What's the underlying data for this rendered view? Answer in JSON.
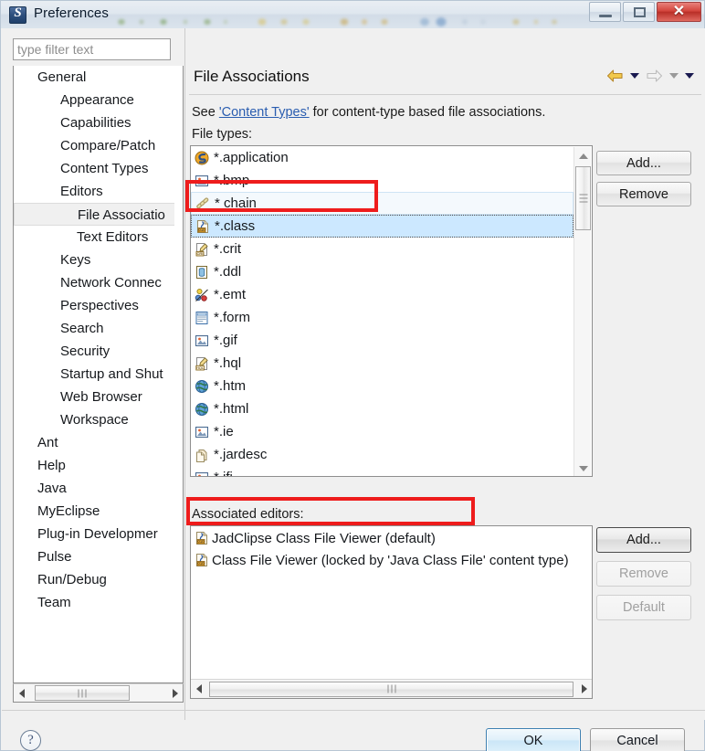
{
  "window": {
    "title": "Preferences",
    "app_icon": "myeclipse-logo-icon",
    "controls": {
      "minimize": "minimize-icon",
      "maximize": "maximize-icon",
      "close": "✕"
    }
  },
  "sidebar": {
    "filter": {
      "value": "",
      "placeholder": "type filter text"
    },
    "items": [
      {
        "label": "General",
        "level": 0,
        "selected": false
      },
      {
        "label": "Appearance",
        "level": 1,
        "selected": false
      },
      {
        "label": "Capabilities",
        "level": 1,
        "selected": false
      },
      {
        "label": "Compare/Patch",
        "level": 1,
        "selected": false
      },
      {
        "label": "Content Types",
        "level": 1,
        "selected": false
      },
      {
        "label": "Editors",
        "level": 1,
        "selected": false
      },
      {
        "label": "File Associatio",
        "level": 2,
        "selected": true
      },
      {
        "label": "Text Editors",
        "level": 2,
        "selected": false
      },
      {
        "label": "Keys",
        "level": 1,
        "selected": false
      },
      {
        "label": "Network Connec",
        "level": 1,
        "selected": false
      },
      {
        "label": "Perspectives",
        "level": 1,
        "selected": false
      },
      {
        "label": "Search",
        "level": 1,
        "selected": false
      },
      {
        "label": "Security",
        "level": 1,
        "selected": false
      },
      {
        "label": "Startup and Shut",
        "level": 1,
        "selected": false
      },
      {
        "label": "Web Browser",
        "level": 1,
        "selected": false
      },
      {
        "label": "Workspace",
        "level": 1,
        "selected": false
      },
      {
        "label": "Ant",
        "level": 0,
        "selected": false
      },
      {
        "label": "Help",
        "level": 0,
        "selected": false
      },
      {
        "label": "Java",
        "level": 0,
        "selected": false
      },
      {
        "label": "MyEclipse",
        "level": 0,
        "selected": false
      },
      {
        "label": "Plug-in Developmer",
        "level": 0,
        "selected": false
      },
      {
        "label": "Pulse",
        "level": 0,
        "selected": false
      },
      {
        "label": "Run/Debug",
        "level": 0,
        "selected": false
      },
      {
        "label": "Team",
        "level": 0,
        "selected": false
      }
    ]
  },
  "content": {
    "page_title": "File Associations",
    "description": {
      "prefix": "See ",
      "link": "'Content Types'",
      "suffix": " for content-type based file associations."
    },
    "file_types_label": "File types:",
    "associated_editors_label": "Associated editors:",
    "nav": {
      "back": "back-arrow-icon",
      "back_menu": "chevron-down-icon",
      "forward": "forward-arrow-icon",
      "forward_menu": "chevron-down-icon",
      "view_menu": "chevron-down-icon"
    }
  },
  "file_types": {
    "items": [
      {
        "label": "*.application",
        "icon": "myeclipse-application-icon",
        "state": "normal"
      },
      {
        "label": "*.bmp",
        "icon": "image-icon",
        "state": "normal"
      },
      {
        "label": "* chain",
        "icon": "chain-icon",
        "state": "hovered"
      },
      {
        "label": "*.class",
        "icon": "class-file-icon",
        "state": "selected"
      },
      {
        "label": "*.crit",
        "icon": "crit-file-icon",
        "state": "normal"
      },
      {
        "label": "*.ddl",
        "icon": "ddl-file-icon",
        "state": "normal"
      },
      {
        "label": "*.emt",
        "icon": "emt-file-icon",
        "state": "normal"
      },
      {
        "label": "*.form",
        "icon": "form-file-icon",
        "state": "normal"
      },
      {
        "label": "*.gif",
        "icon": "image-icon",
        "state": "normal"
      },
      {
        "label": "*.hql",
        "icon": "hql-file-icon",
        "state": "normal"
      },
      {
        "label": "*.htm",
        "icon": "globe-icon",
        "state": "normal"
      },
      {
        "label": "*.html",
        "icon": "globe-icon",
        "state": "normal"
      },
      {
        "label": "*.ie",
        "icon": "image-icon",
        "state": "normal"
      },
      {
        "label": "*.jardesc",
        "icon": "jar-description-icon",
        "state": "normal"
      },
      {
        "label": "*.jfi",
        "icon": "image-icon",
        "state": "normal"
      }
    ],
    "add_button": "Add...",
    "remove_button": "Remove"
  },
  "associated_editors": {
    "items": [
      {
        "label": "JadClipse Class File Viewer (default)",
        "icon": "class-file-icon"
      },
      {
        "label": "Class File Viewer (locked by 'Java Class File' content type)",
        "icon": "class-file-icon"
      }
    ],
    "add_button": "Add...",
    "remove_button": "Remove",
    "default_button": "Default"
  },
  "footer": {
    "help": "?",
    "ok": "OK",
    "cancel": "Cancel"
  },
  "annotations": {
    "class_row": "red-highlight-box",
    "jadclipse_row": "red-highlight-box"
  },
  "colors": {
    "annotation_red": "#ee1c1c",
    "selection_blue": "#cce8ff",
    "link_blue": "#2a5db0",
    "default_button_blue": "#3c7fb1",
    "close_button_red": "#d4453c"
  }
}
